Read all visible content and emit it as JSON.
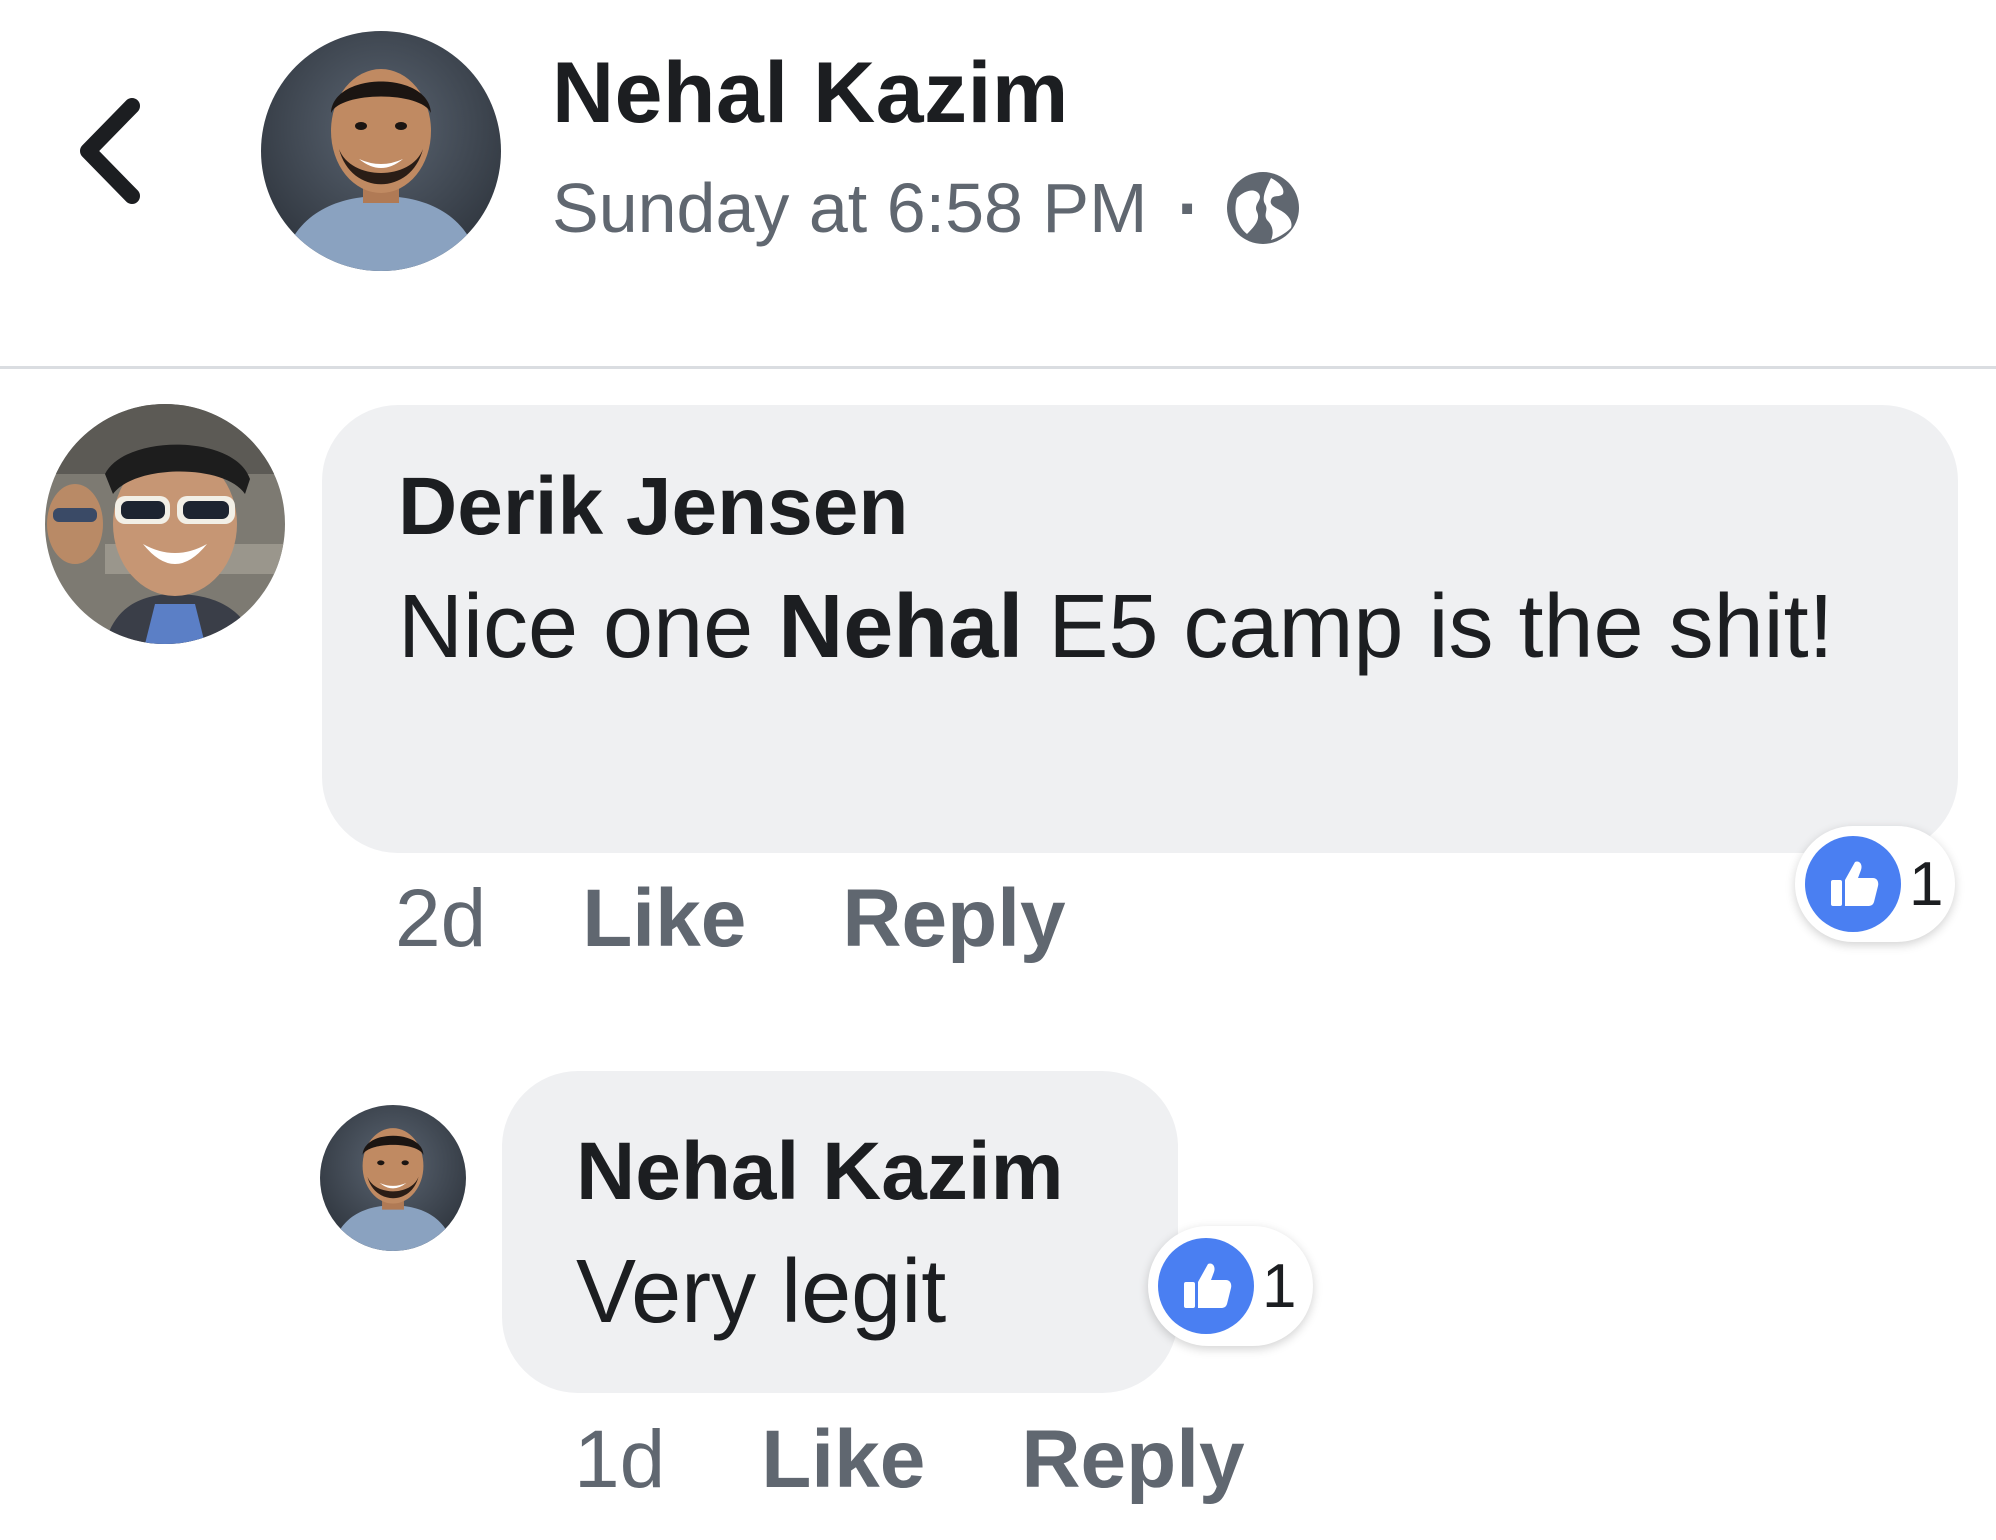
{
  "header": {
    "author_name": "Nehal Kazim",
    "timestamp": "Sunday at 6:58 PM",
    "separator": "·",
    "audience_icon": "globe-icon",
    "back_icon": "chevron-left-icon"
  },
  "comments": [
    {
      "author": "Derik Jensen",
      "text_before": "Nice one ",
      "mention": "Nehal",
      "text_after": " E5 camp is the shit!",
      "age": "2d",
      "like_label": "Like",
      "reply_label": "Reply",
      "reaction_icon": "thumbs-up-icon",
      "reaction_count": "1"
    },
    {
      "author": "Nehal Kazim",
      "text": "Very legit",
      "age": "1d",
      "like_label": "Like",
      "reply_label": "Reply",
      "reaction_icon": "thumbs-up-icon",
      "reaction_count": "1"
    }
  ],
  "colors": {
    "bubble": "#eff0f2",
    "like_blue": "#4a7ff2",
    "meta_gray": "#606770",
    "text": "#1c1e21"
  }
}
